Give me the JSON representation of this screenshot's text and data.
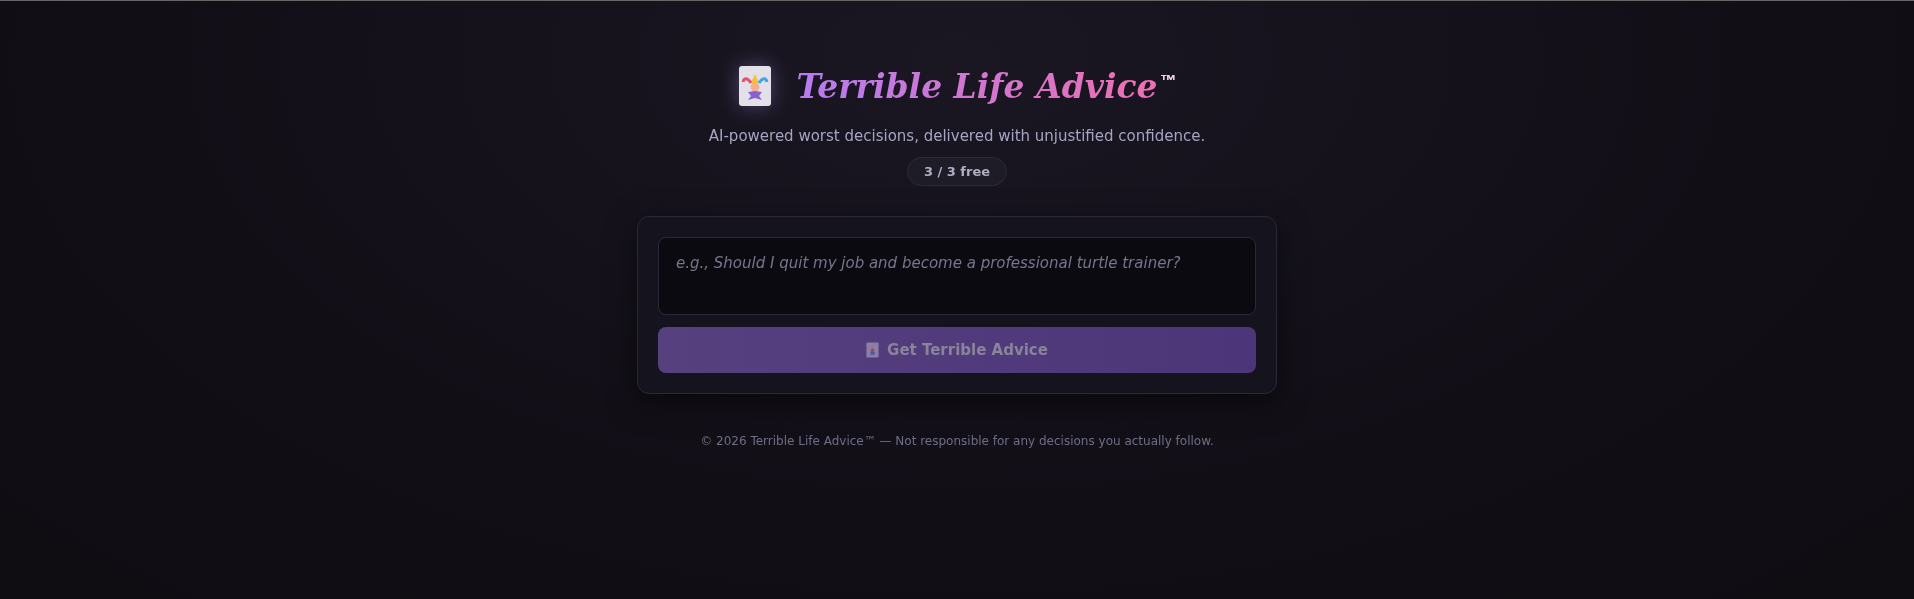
{
  "header": {
    "title": "Terrible Life Advice",
    "title_mark": "™",
    "tagline": "AI-powered worst decisions, delivered with unjustified confidence.",
    "quota_badge": "3 / 3 free"
  },
  "form": {
    "question": {
      "placeholder": "e.g., Should I quit my job and become a professional turtle trainer?"
    },
    "submit": {
      "label": "Get Terrible Advice",
      "disabled": true
    }
  },
  "footer": "© 2026 Terrible Life Advice™ — Not responsible for any decisions you actually follow."
}
